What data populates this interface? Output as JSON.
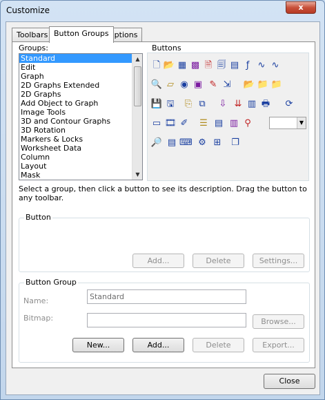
{
  "window": {
    "title": "Customize",
    "close_glyph": "x"
  },
  "tabs": [
    "Toolbars",
    "Button Groups",
    "Options"
  ],
  "groups": {
    "label": "Groups:",
    "items": [
      "Standard",
      "Edit",
      "Graph",
      "2D Graphs Extended",
      "2D Graphs",
      "Add Object to Graph",
      "Image Tools",
      "3D and Contour Graphs",
      "3D Rotation",
      "Markers & Locks",
      "Worksheet Data",
      "Column",
      "Layout",
      "Mask"
    ],
    "selected": "Standard"
  },
  "buttons_label": "Buttons",
  "icons": [
    "new-page-icon",
    "open-folder-icon",
    "new-worksheet-icon",
    "new-matrix-icon",
    "new-excel-icon",
    "new-notes-icon",
    "new-layout-icon",
    "new-function-icon",
    "new-graph-icon",
    "new-3d-graph-icon",
    "magnifier-graph-icon",
    "surface-icon",
    "globe-icon",
    "image-icon",
    "notes-edit-icon",
    "import-icon",
    "open-project-icon",
    "open-template-icon",
    "open-excel-icon",
    "save-icon",
    "save-template-icon",
    "print-layout-icon",
    "duplicate-icon",
    "import-ascii-icon",
    "import-multiple-icon",
    "import-wizard-icon",
    "print-icon",
    "refresh-icon",
    "presentation-icon",
    "film-icon",
    "pen-icon",
    "table-rows-icon",
    "table-image-icon",
    "table-export-icon",
    "tree-icon",
    "search-icon",
    "results-log-icon",
    "code-builder-icon",
    "settings-gear-icon",
    "add-column-icon",
    "folder-stack-icon"
  ],
  "description": "Select a group, then click a button to see its description. Drag the button to any toolbar.",
  "button_section": {
    "title": "Button",
    "add": "Add...",
    "delete": "Delete",
    "settings": "Settings..."
  },
  "button_group": {
    "title": "Button Group",
    "name_label": "Name:",
    "name_value": "Standard",
    "bitmap_label": "Bitmap:",
    "bitmap_value": "",
    "browse": "Browse...",
    "new": "New...",
    "add": "Add...",
    "delete": "Delete",
    "export": "Export..."
  },
  "close": "Close"
}
